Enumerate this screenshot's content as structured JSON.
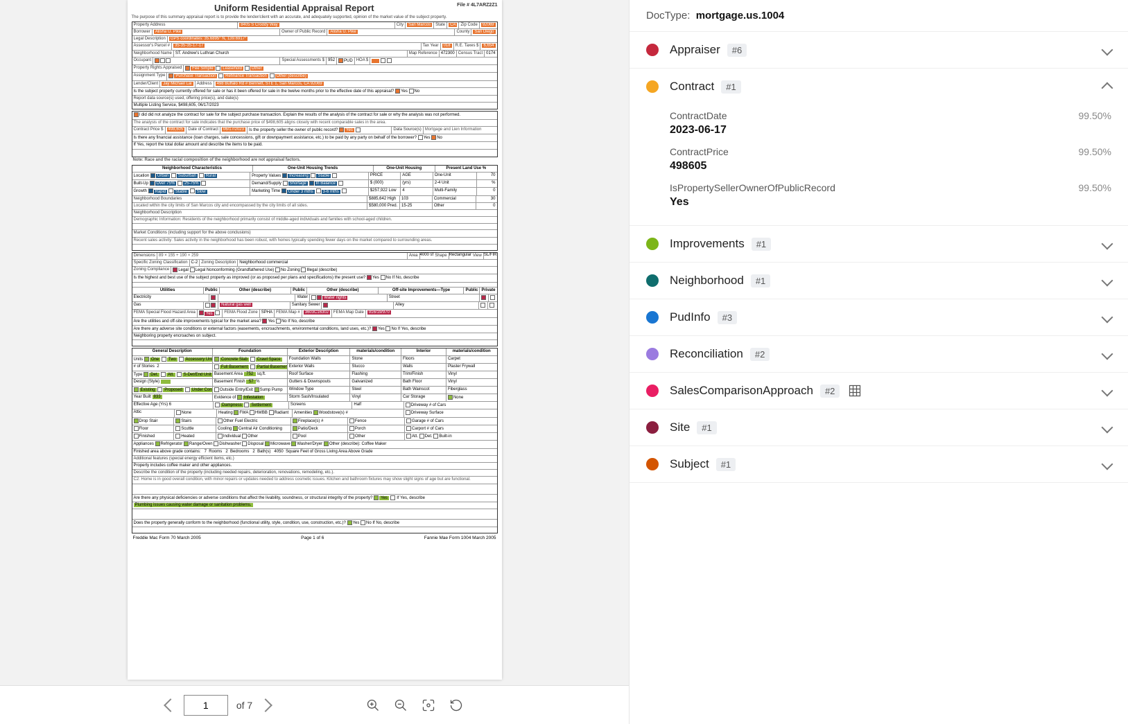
{
  "doc": {
    "title": "Uniform Residential Appraisal Report",
    "fileLabel": "File #",
    "fileNo": "4L7ARZ2Z1",
    "intro": "The purpose of this summary appraisal report is to provide the lender/client with an accurate, and adequately supported, opinion of the market value of the subject property.",
    "propAddressLbl": "Property Address",
    "propAddress": "8405 S Croddy Way",
    "cityLbl": "City",
    "city": "San Marcos",
    "stateLbl": "State",
    "state": "CA",
    "zipLbl": "Zip Code",
    "zip": "92069",
    "borrowerLbl": "Borrower",
    "borrower": "Alisha U. Pike",
    "ownerLbl": "Owner of Public Record",
    "owner": "Alisha U. Pike",
    "countyLbl": "County",
    "county": "San Diego",
    "legalLbl": "Legal Description",
    "legal": "GPS coordinates: 35.6895° N, 139.6917°",
    "parcelLbl": "Assessor's Parcel #",
    "parcel": "35-35-35-17-17",
    "taxYearLbl": "Tax Year",
    "taxYear": "018",
    "reTaxesLbl": "R.E. Taxes $",
    "reTaxes": "6,654",
    "nbhdNameLbl": "Neighborhood Name",
    "nbhdName": "ST. Andrew's Luthran Church",
    "mapRefLbl": "Map Reference",
    "mapRef": "472300",
    "censusLbl": "Census Tract",
    "census": "0174",
    "occupantLbl": "Occupant",
    "assessLbl": "Special Assessments $",
    "assess": "952",
    "hoaLbl": "HOA $",
    "rightsLbl": "Property Rights Appraised",
    "assignLbl": "Assignment Type",
    "lenderLbl": "Lender/Client",
    "lender": "Jay Michael Lai",
    "lenderAddrLbl": "Address",
    "lenderAddr": "498 Buffalo Rd # Bennett, STE 1, San Marcos, CA 92069",
    "offerQ": "Is the subject property currently offered for sale or has it been offered for sale in the twelve months prior to the effective date of this appraisal?",
    "reportSrc": "Report data source(s) used, offering price(s), and date(s)",
    "mls": "Multiple Listing Service, $498,605, 06/17/2023",
    "analyzeQ": "I did   did not analyze the contract for sale for the subject purchase transaction. Explain the results of the analysis of the contract for sale or why the analysis was not performed.",
    "analyzeTxt": "The analysis of the contract for sale indicates that the purchase price of $498,605 aligns closely with recent comparable sales in the area.",
    "cpLbl": "Contract Price $",
    "cp": "498,605",
    "cdLbl": "Date of Contract",
    "cd": "06/17/2023",
    "cpOwnerQ": "Is the property seller the owner of public record?",
    "dsLbl": "Data Source(s)",
    "ds": "Mortgage and Lien Information",
    "assistQ": "Is there any financial assistance (loan charges, sale concessions, gift or downpayment assistance, etc.) to be paid by any party on behalf of the borrower?",
    "assistTxt": "If Yes, report the total dollar amount and describe the items to be paid.",
    "raceNote": "Note: Race and the racial composition of the neighborhood are not appraisal factors.",
    "nbhdCharHdr": "Neighborhood Characteristics",
    "trendsHdr": "One-Unit Housing Trends",
    "housingHdr": "One-Unit Housing",
    "landUseHdr": "Present Land Use %",
    "locLbl": "Location",
    "builtUpLbl": "Built-Up",
    "growthLbl": "Growth",
    "propValLbl": "Property Values",
    "demSupLbl": "Demand/Supply",
    "mktTimeLbl": "Marketing Time",
    "priceLbl": "PRICE",
    "ageLbl": "AGE",
    "oneUnitLbl": "One-Unit",
    "twoFourLbl": "2-4 Unit",
    "multiLbl": "Multi-Family",
    "commLbl": "Commercial",
    "otherLbl": "Other",
    "price1": "$ (000)",
    "price2": "(yrs)",
    "pl1": "$257,922 Low",
    "pl2": "4",
    "pm1": "$885,642 High",
    "pm2": "103",
    "ph1": "$580,000 Pred.",
    "ph2": "15-25",
    "oneUnitPct": "70",
    "commPct": "30",
    "otherPct": "0",
    "nbhdBoundLbl": "Neighborhood Boundaries",
    "nbhdBound": "Located within the city limits of San Marcos city and encompassed by the city limits of all sides.",
    "nbhdDescLbl": "Neighborhood Description",
    "nbhdDesc": "Demographic Information: Residents of the neighborhood primarily consist of middle-aged individuals and families with school-aged children.",
    "mktCondLbl": "Market Conditions (including support for the above conclusions)",
    "mktCond": "Recent sales activity: Sales activity in the neighborhood has been robust, with homes typically spending fewer days on the market compared to surrounding areas.",
    "dimLbl": "Dimensions",
    "dim": "89 × 155 + 190 × 259",
    "areaLbl": "Area",
    "area": "4000 sf",
    "shapeLbl": "Shape",
    "shape": "Rectangular",
    "viewLbl": "View",
    "view": "SL/FIR",
    "zoneClassLbl": "Specific Zoning Classification",
    "zoneClass": "C-2",
    "zoneDescLbl": "Zoning Description",
    "zoneDesc": "Neighborhood commercial",
    "zoneCompLbl": "Zoning Compliance",
    "bestUseQ": "Is the highest and best use of the subject property as improved (or as proposed per plans and specifications) the present use?",
    "utilHdr": "Utilities",
    "pubLbl": "Public",
    "otherDescLbl": "Other (describe)",
    "elecLbl": "Electricity",
    "gasLbl": "Gas",
    "gasDesc": "Natural gas well",
    "waterLbl": "Water",
    "sewerLbl": "Sanitary Sewer",
    "offsiteHdr": "Off-site Improvements—Type",
    "privLbl": "Private",
    "streetLbl": "Street",
    "alleyLbl": "Alley",
    "waterRights": "Water rights",
    "femaLbl": "FEMA Special Flood Hazard Area",
    "femaZoneLbl": "FEMA Flood Zone",
    "femaZone": "SPHA",
    "femaMapLbl": "FEMA Map #",
    "femaMap": "3603C1630J",
    "femaDateLbl": "FEMA Map Date",
    "femaDate": "916/19/970",
    "utilQ": "Are the utilities and off-site improvements typical for the market area?",
    "adverseQ": "Are there any adverse site conditions or external factors (easements, encroachments, environmental conditions, land uses, etc.)?",
    "adverseTxt": "Neighboring property encroaches on subject.",
    "genDescHdr": "General Description",
    "foundationHdr": "Foundation",
    "extDescHdr": "Exterior Description",
    "matCondHdr": "materials/condition",
    "interiorHdr": "Interior",
    "unitsLbl": "Units",
    "storiesLbl": "# of Stories",
    "stories": "2",
    "typeLbl": "Type",
    "designLbl": "Design (Style)",
    "yearBuiltLbl": "Year Built",
    "yearBuilt": "833",
    "effAgeLbl": "Effective Age (Yrs)",
    "effAge": "6",
    "atticLbl": "Attic",
    "basementAreaLbl": "Basement Area",
    "basementFinLbl": "Basement Finish",
    "outsideEntryLbl": "Outside Entry/Exit",
    "evidenceLbl": "Evidence of",
    "infest": "Infestation",
    "foundWallsLbl": "Foundation Walls",
    "foundWalls": "Stone",
    "extWallsLbl": "Exterior Walls",
    "extWalls": "Stucco",
    "roofLbl": "Roof Surface",
    "roof": "Flashing",
    "guttersLbl": "Gutters & Downspouts",
    "gutters": "Galvanized",
    "windowLbl": "Window Type",
    "window": "Steel",
    "stormLbl": "Storm Sash/Insulated",
    "storm": "Vinyl",
    "screensLbl": "Screens",
    "screens": "Half",
    "floorsLbl": "Floors",
    "floors": "Carpet",
    "wallsLbl": "Walls",
    "walls": "Plaster Frywall",
    "trimLbl": "Trim/Finish",
    "trim": "Vinyl",
    "bathFloorLbl": "Bath Floor",
    "bathFloor": "Vinyl",
    "bathWainLbl": "Bath Wainscot",
    "bathWain": "Fiberglass",
    "carStorageLbl": "Car Storage",
    "drivewayLbl": "Driveway  # of Cars",
    "drivewaySurfLbl": "Driveway Surface",
    "garageLbl": "Garage   # of Cars",
    "carportLbl": "Carport   # of Cars",
    "heatingLbl": "Heating",
    "coolingLbl": "Cooling",
    "fuelLbl": "Fuel",
    "fuel": "Electric",
    "amenitiesLbl": "Amenities",
    "woodstove": "Woodstove(s) #",
    "fireplace": "Fireplace(s) #",
    "fence": "Fence",
    "patio": "Patio/Deck",
    "porch": "Porch",
    "pool": "Pool",
    "appliancesLbl": "Appliances",
    "applianceOther": "Other (describe):",
    "coffeeMaker": "Coffee Maker",
    "finAreaLbl": "Finished area above grade contains:",
    "rooms": "7",
    "roomsLbl": "Rooms",
    "bedrooms": "2",
    "bedroomsLbl": "Bedrooms",
    "baths": "2",
    "bathsLbl": "Bath(s)",
    "sqft": "4050",
    "sqftLbl": "Square Feet of Gross Living Area Above Grade",
    "addlFeatLbl": "Additional features (special energy efficient items, etc.)",
    "addlFeat": "Property includes coffee maker and other appliances.",
    "condLbl": "Describe the condition of the property (including needed repairs, deterioration, renovations, remodeling, etc.).",
    "cond": "C2: Home is in good overall condition, with minor repairs or updates needed to address cosmetic issues. Kitchen and bathroom fixtures may show slight signs of age but are functional.",
    "defQ": "Are there any physical deficiencies or adverse conditions that affect the livability, soundness, or structural integrity of the property?",
    "defTxt": "Plumbing issues causing water damage or sanitation problems.",
    "conformQ": "Does the property generally conform to the neighborhood (functional utility, style, condition, use, construction, etc.)?",
    "footerL": "Freddie Mac Form 70  March 2005",
    "footerM": "Page 1 of 6",
    "footerR": "Fannie Mae Form 1004  March 2005",
    "yes": "Yes",
    "no": "No",
    "none": "None",
    "dropStair": "Drop Stair",
    "stairsLbl": "Stairs",
    "scuttle": "Scuttle",
    "floor": "Floor",
    "finished": "Finished",
    "heated": "Heated",
    "fwa": "FWA",
    "hwbb": "HWBB",
    "radiant": "Radiant",
    "centralAir": "Central Air Conditioning",
    "individual": "Individual",
    "refrig": "Refrigerator",
    "rangeOven": "Range/Oven",
    "dishwasher": "Dishwasher",
    "disposal": "Disposal",
    "microwave": "Microwave",
    "washerDryer": "Washer/Dryer",
    "sumpPump": "Sump Pump",
    "sqftUnit": "sq.ft.",
    "legalOpt": "Legal",
    "legalNon": "Legal Nonconforming (Grandfathered Use)",
    "noZoning": "No Zoning",
    "illegal": "Illegal (describe)",
    "pud": "PUD",
    "att": "Att.",
    "det": "Det.",
    "builtIn": "Built-in"
  },
  "pager": {
    "page": "1",
    "of": "of 7"
  },
  "side": {
    "docTypeLbl": "DocType:",
    "docType": "mortgage.us.1004",
    "cats": [
      {
        "name": "Appraiser",
        "count": "#6",
        "color": "#c5283d",
        "open": false
      },
      {
        "name": "Contract",
        "count": "#1",
        "color": "#f5a623",
        "open": true,
        "fields": [
          {
            "label": "ContractDate",
            "value": "2023-06-17",
            "conf": "99.50%"
          },
          {
            "label": "ContractPrice",
            "value": "498605",
            "conf": "99.50%"
          },
          {
            "label": "IsPropertySellerOwnerOfPublicRecord",
            "value": "Yes",
            "conf": "99.50%"
          }
        ]
      },
      {
        "name": "Improvements",
        "count": "#1",
        "color": "#7cb518",
        "open": false
      },
      {
        "name": "Neighborhood",
        "count": "#1",
        "color": "#0f6d6d",
        "open": false
      },
      {
        "name": "PudInfo",
        "count": "#3",
        "color": "#1976d2",
        "open": false
      },
      {
        "name": "Reconciliation",
        "count": "#2",
        "color": "#9b7be0",
        "open": false
      },
      {
        "name": "SalesComparisonApproach",
        "count": "#2",
        "color": "#e91e63",
        "open": false,
        "grid": true
      },
      {
        "name": "Site",
        "count": "#1",
        "color": "#8b1e3f",
        "open": false
      },
      {
        "name": "Subject",
        "count": "#1",
        "color": "#d35400",
        "open": false
      }
    ]
  }
}
